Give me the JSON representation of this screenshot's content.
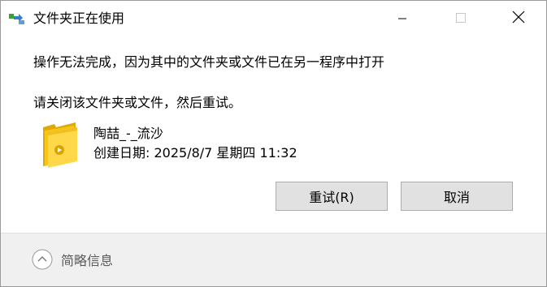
{
  "window": {
    "title": "文件夹正在使用",
    "icon": "file-transfer-icon"
  },
  "titlebar_controls": {
    "minimize_icon": "minimize-icon",
    "maximize_icon": "maximize-icon",
    "close_icon": "close-icon"
  },
  "message": {
    "main": "操作无法完成，因为其中的文件夹或文件已在另一程序中打开",
    "sub": "请关闭该文件夹或文件，然后重试。"
  },
  "file": {
    "icon": "folder-icon",
    "name": "陶喆_-_流沙",
    "created": "创建日期: 2025/8/7 星期四 11:32"
  },
  "buttons": {
    "retry_label": "重试(R)",
    "cancel_label": "取消"
  },
  "footer": {
    "details_label": "简略信息",
    "details_icon": "chevron-up-circle-icon"
  },
  "colors": {
    "button_bg": "#e1e1e1",
    "button_border": "#adadad",
    "footer_bg": "#f0f0f0",
    "folder_yellow": "#f5c518",
    "footer_text": "#5a5a5a"
  }
}
